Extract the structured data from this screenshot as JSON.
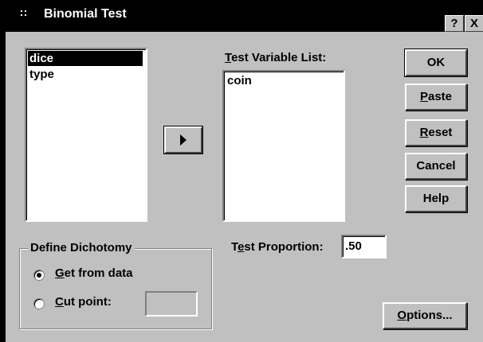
{
  "window": {
    "title": "Binomial Test",
    "help_button": "?",
    "close_button": "X"
  },
  "source_list": {
    "items": [
      "dice",
      "type"
    ],
    "selected_index": 0
  },
  "move_button": {
    "icon": "right-arrow-icon"
  },
  "test_variable_list": {
    "label_mnemonic": "T",
    "label_rest": "est Variable List:",
    "items": [
      "coin"
    ]
  },
  "buttons": {
    "ok": "OK",
    "paste_mnemonic": "P",
    "paste_rest": "aste",
    "reset_mnemonic": "R",
    "reset_rest": "eset",
    "cancel": "Cancel",
    "help": "Help",
    "options_mnemonic": "O",
    "options_rest": "ptions..."
  },
  "define_dichotomy": {
    "title": "Define Dichotomy",
    "get_from_data_mnemonic": "G",
    "get_from_data_rest": "et from data",
    "cut_point_mnemonic": "C",
    "cut_point_rest": "ut point:",
    "selected": "get_from_data",
    "cut_point_value": ""
  },
  "test_proportion": {
    "label_t": "T",
    "label_mnemonic": "e",
    "label_rest": "st Proportion:",
    "value": ".50"
  }
}
